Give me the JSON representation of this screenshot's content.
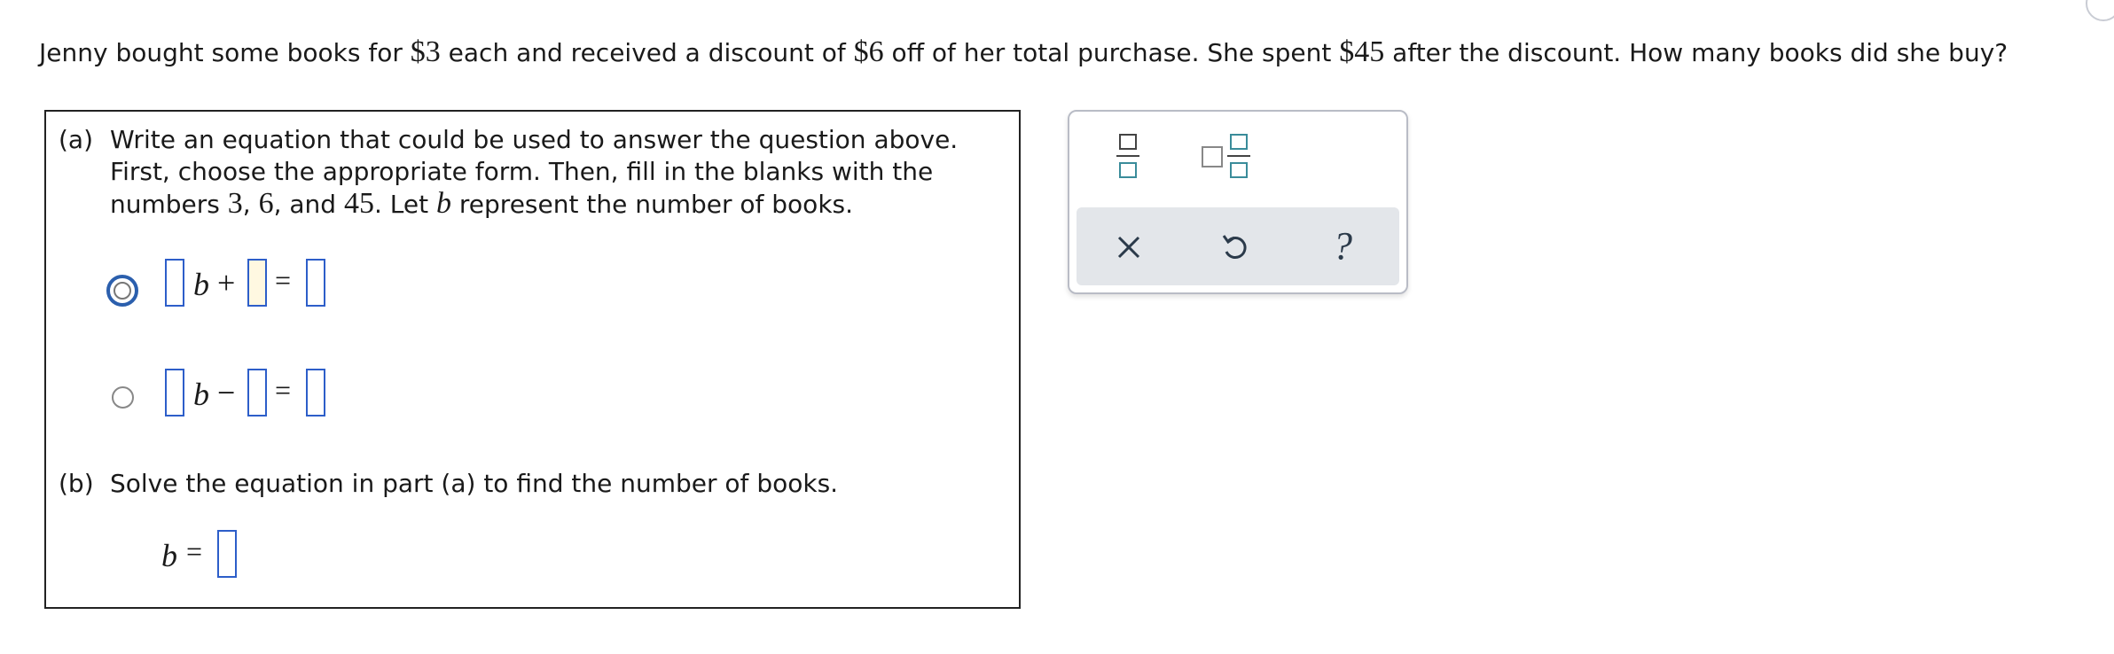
{
  "question": {
    "p1": "Jenny bought some books for ",
    "amt1": "$3",
    "p2": " each and received a discount of ",
    "amt2": "$6",
    "p3": " off of her total purchase. She spent ",
    "amt3": "$45",
    "p4": " after the discount. How many books did she buy?"
  },
  "part_a": {
    "label": "(a)",
    "line1": "Write an equation that could be used to answer the question above.",
    "line2": "First, choose the appropriate form. Then, fill in the blanks with the",
    "line3_a": "numbers ",
    "n1": "3",
    "sep1": ", ",
    "n2": "6",
    "sep2": ", and ",
    "n3": "45",
    "line3_b": ". Let ",
    "var": "b",
    "line3_c": " represent the number of books."
  },
  "equation_options": [
    {
      "variable": "b",
      "operator": "+",
      "equals": "=",
      "selected": true
    },
    {
      "variable": "b",
      "operator": "−",
      "equals": "=",
      "selected": false
    }
  ],
  "part_b": {
    "label": "(b)",
    "text": "Solve the equation in part (a) to find the number of books.",
    "answer_variable": "b",
    "answer_equals": "="
  },
  "toolbox": {
    "icons": [
      "fraction-icon",
      "mixed-number-icon",
      "clear-icon",
      "undo-icon",
      "help-icon"
    ],
    "help_symbol": "?"
  },
  "colors": {
    "blank_border": "#2d5ec9",
    "active_blank_fill": "#fff8e1",
    "radio_selected": "#2b5fad",
    "tool_teal": "#3a8c9a",
    "toolbar_bg": "#e3e6ea"
  }
}
